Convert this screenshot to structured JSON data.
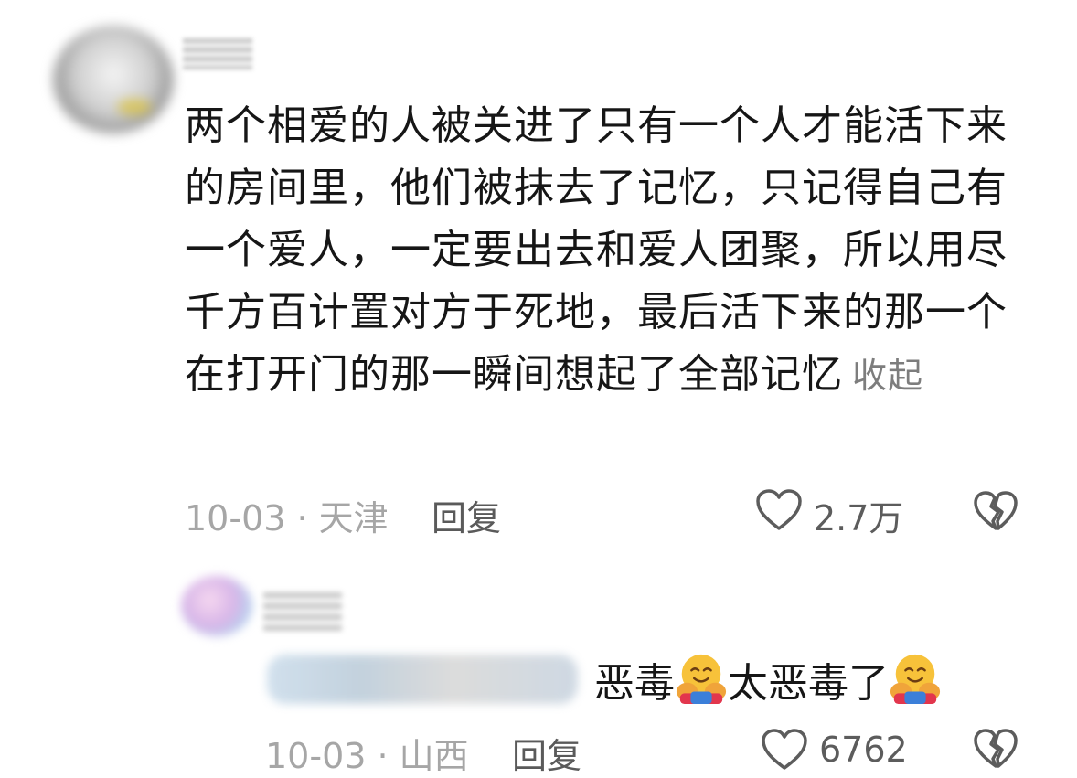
{
  "comment_1": {
    "text": "两个相爱的人被关进了只有一个人才能活下来的房间里，他们被抹去了记忆，只记得自己有一个爱人，一定要出去和爱人团聚，所以用尽千方百计置对方于死地，最后活下来的那一个在打开门的那一瞬间想起了全部记忆",
    "collapse_label": "收起",
    "meta": "10-03 · 天津",
    "reply_label": "回复",
    "like_count": "2.7万"
  },
  "comment_2": {
    "text_part1": "恶毒",
    "text_part2": "太恶毒了",
    "meta": "10-03 · 山西",
    "reply_label": "回复",
    "like_count": "6762"
  },
  "icons": {
    "like": "heart-outline-icon",
    "dislike": "broken-heart-icon",
    "emoji": "hugging-face-emoji"
  }
}
